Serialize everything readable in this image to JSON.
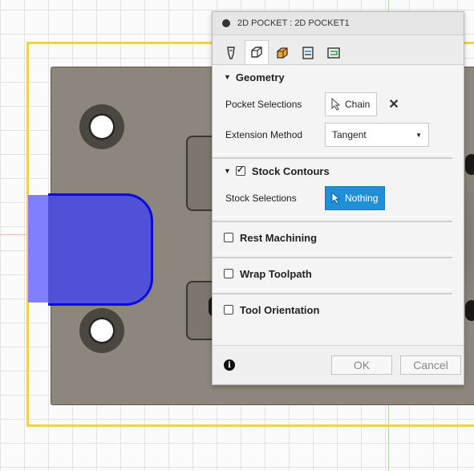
{
  "dialog": {
    "title": "2D POCKET : 2D POCKET1",
    "tabs": [
      {
        "icon": "tool-icon"
      },
      {
        "icon": "geometry-icon"
      },
      {
        "icon": "heights-icon"
      },
      {
        "icon": "passes-icon"
      },
      {
        "icon": "linking-icon"
      }
    ],
    "geometry": {
      "header": "Geometry",
      "pocket_selections_label": "Pocket Selections",
      "pocket_selections_value": "Chain",
      "extension_method_label": "Extension Method",
      "extension_method_value": "Tangent"
    },
    "stock_contours": {
      "header": "Stock Contours",
      "checked": true,
      "stock_selections_label": "Stock Selections",
      "stock_selections_value": "Nothing"
    },
    "rest_machining": {
      "header": "Rest Machining",
      "checked": false
    },
    "wrap_toolpath": {
      "header": "Wrap Toolpath",
      "checked": false
    },
    "tool_orientation": {
      "header": "Tool Orientation",
      "checked": false
    },
    "info_glyph": "i",
    "ok_label": "OK",
    "cancel_label": "Cancel"
  },
  "colors": {
    "selection_blue": "#1f8fd6",
    "stock_boundary": "#f2d33a",
    "pocket_highlight": "#0a0adc"
  }
}
